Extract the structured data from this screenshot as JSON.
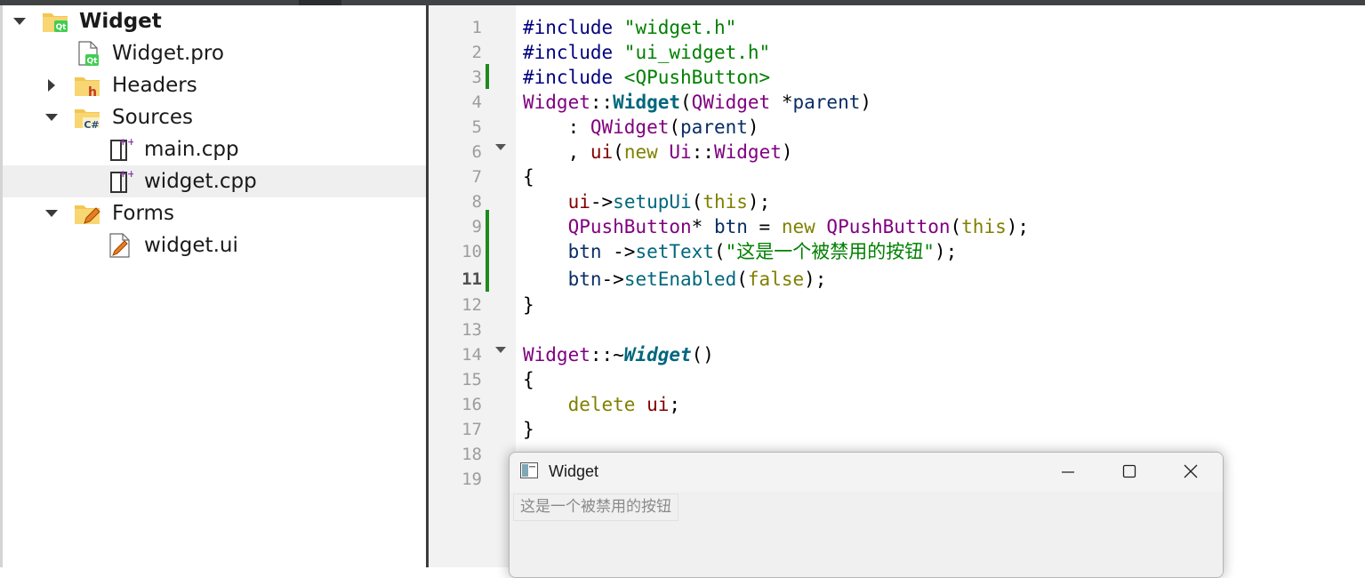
{
  "project_tree": {
    "items": [
      {
        "label": "Widget",
        "icon": "qt-project-folder-icon",
        "expanded": true,
        "bold": true
      },
      {
        "label": "Widget.pro",
        "icon": "qt-pro-file-icon"
      },
      {
        "label": "Headers",
        "icon": "headers-folder-icon",
        "expanded": false
      },
      {
        "label": "Sources",
        "icon": "sources-folder-icon",
        "expanded": true
      },
      {
        "label": "main.cpp",
        "icon": "cpp-file-icon"
      },
      {
        "label": "widget.cpp",
        "icon": "cpp-file-icon",
        "selected": true
      },
      {
        "label": "Forms",
        "icon": "forms-folder-icon",
        "expanded": true
      },
      {
        "label": "widget.ui",
        "icon": "ui-file-icon"
      }
    ]
  },
  "editor": {
    "current_line": 11,
    "line_numbers": [
      "1",
      "2",
      "3",
      "4",
      "5",
      "6",
      "7",
      "8",
      "9",
      "10",
      "11",
      "12",
      "13",
      "14",
      "15",
      "16",
      "17",
      "18",
      "19"
    ],
    "lines": [
      [
        [
          "#include ",
          "pp"
        ],
        [
          "\"widget.h\"",
          "str"
        ]
      ],
      [
        [
          "#include ",
          "pp"
        ],
        [
          "\"ui_widget.h\"",
          "str"
        ]
      ],
      [
        [
          "#include ",
          "pp"
        ],
        [
          "<QPushButton>",
          "str"
        ]
      ],
      [
        [
          "Widget",
          "type"
        ],
        [
          "::",
          "plain"
        ],
        [
          "Widget",
          "fnb"
        ],
        [
          "(",
          "plain"
        ],
        [
          "QWidget",
          "type"
        ],
        [
          " ",
          "plain"
        ],
        [
          "*",
          "plain"
        ],
        [
          "parent",
          "var"
        ],
        [
          ")",
          "plain"
        ]
      ],
      [
        [
          "    : ",
          "plain"
        ],
        [
          "QWidget",
          "type"
        ],
        [
          "(",
          "plain"
        ],
        [
          "parent",
          "var"
        ],
        [
          ")",
          "plain"
        ]
      ],
      [
        [
          "    , ",
          "plain"
        ],
        [
          "ui",
          "mem"
        ],
        [
          "(",
          "plain"
        ],
        [
          "new",
          "kw"
        ],
        [
          " ",
          "plain"
        ],
        [
          "Ui",
          "type"
        ],
        [
          "::",
          "plain"
        ],
        [
          "Widget",
          "type"
        ],
        [
          ")",
          "plain"
        ]
      ],
      [
        [
          "{",
          "plain"
        ]
      ],
      [
        [
          "    ",
          "plain"
        ],
        [
          "ui",
          "mem"
        ],
        [
          "->",
          "plain"
        ],
        [
          "setupUi",
          "fn"
        ],
        [
          "(",
          "plain"
        ],
        [
          "this",
          "kw"
        ],
        [
          ");",
          "plain"
        ]
      ],
      [
        [
          "    ",
          "plain"
        ],
        [
          "QPushButton",
          "type"
        ],
        [
          "* ",
          "plain"
        ],
        [
          "btn",
          "var"
        ],
        [
          " = ",
          "plain"
        ],
        [
          "new",
          "kw"
        ],
        [
          " ",
          "plain"
        ],
        [
          "QPushButton",
          "type"
        ],
        [
          "(",
          "plain"
        ],
        [
          "this",
          "kw"
        ],
        [
          ");",
          "plain"
        ]
      ],
      [
        [
          "    ",
          "plain"
        ],
        [
          "btn",
          "var"
        ],
        [
          " ->",
          "plain"
        ],
        [
          "setText",
          "fn"
        ],
        [
          "(",
          "plain"
        ],
        [
          "\"这是一个被禁用的按钮\"",
          "str"
        ],
        [
          ");",
          "plain"
        ]
      ],
      [
        [
          "    ",
          "plain"
        ],
        [
          "btn",
          "var"
        ],
        [
          "->",
          "plain"
        ],
        [
          "setEnabled",
          "fn"
        ],
        [
          "(",
          "plain"
        ],
        [
          "false",
          "kw"
        ],
        [
          ");",
          "plain"
        ]
      ],
      [
        [
          "}",
          "plain"
        ]
      ],
      [],
      [
        [
          "Widget",
          "type"
        ],
        [
          "::~",
          "plain"
        ],
        [
          "Widget",
          "fnbi"
        ],
        [
          "()",
          "plain"
        ]
      ],
      [
        [
          "{",
          "plain"
        ]
      ],
      [
        [
          "    ",
          "plain"
        ],
        [
          "delete",
          "kw"
        ],
        [
          " ",
          "plain"
        ],
        [
          "ui",
          "mem"
        ],
        [
          ";",
          "plain"
        ]
      ],
      [
        [
          "}",
          "plain"
        ]
      ],
      [],
      []
    ]
  },
  "popup_window": {
    "title": "Widget",
    "icon": "qt-window-icon",
    "controls": [
      "minimize-icon",
      "maximize-icon",
      "close-icon"
    ],
    "disabled_button_text": "这是一个被禁用的按钮"
  }
}
